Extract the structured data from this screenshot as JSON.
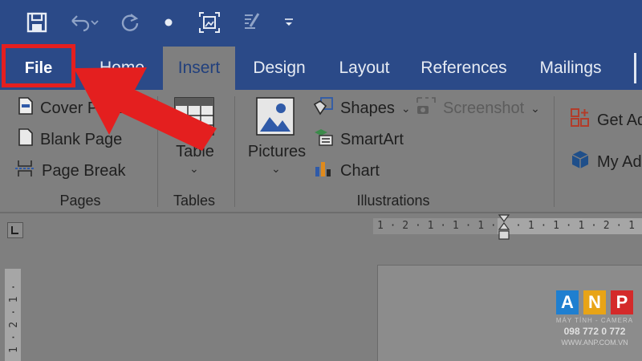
{
  "tabs": [
    {
      "label": "File"
    },
    {
      "label": "Home"
    },
    {
      "label": "Insert"
    },
    {
      "label": "Design"
    },
    {
      "label": "Layout"
    },
    {
      "label": "References"
    },
    {
      "label": "Mailings"
    }
  ],
  "ribbon": {
    "pages": {
      "group_label": "Pages",
      "cover_page": "Cover Page",
      "blank_page": "Blank Page",
      "page_break": "Page Break"
    },
    "tables": {
      "group_label": "Tables",
      "table": "Table"
    },
    "illustrations": {
      "group_label": "Illustrations",
      "pictures": "Pictures",
      "shapes": "Shapes",
      "smartart": "SmartArt",
      "chart": "Chart",
      "screenshot": "Screenshot"
    },
    "addins": {
      "get": "Get Ad",
      "my": "My Ad"
    }
  },
  "ruler": {
    "h": "1 · 2 · 1 · 1 · 1 ·   · 1 · 1 · 1 · 2 · 1",
    "v": "1 · 2 · 1 ·"
  },
  "watermark": {
    "letters": [
      "A",
      "N",
      "P"
    ],
    "sub": "MÁY TÍNH - CAMERA",
    "phone": "098 772 0 772",
    "url": "WWW.ANP.COM.VN"
  },
  "colors": {
    "title_bar": "#2b4a88",
    "highlight": "#e41f1f",
    "logo_a": "#1f7fd0",
    "logo_n": "#e8a416",
    "logo_p": "#d42a2a"
  }
}
